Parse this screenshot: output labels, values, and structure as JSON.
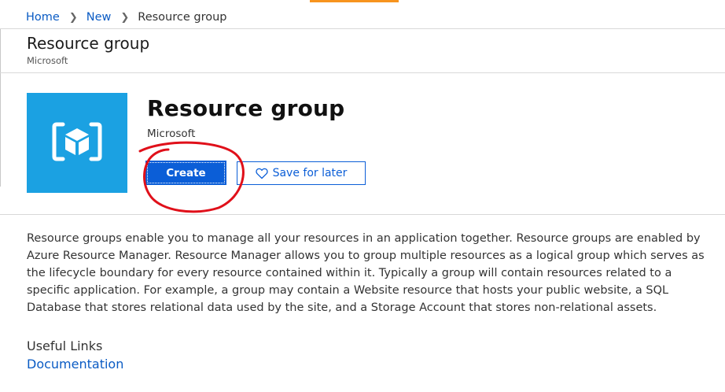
{
  "breadcrumb": {
    "home": "Home",
    "new": "New",
    "current": "Resource group"
  },
  "blade": {
    "title": "Resource group",
    "subtitle": "Microsoft"
  },
  "product": {
    "title": "Resource group",
    "publisher": "Microsoft",
    "icon": "resource-group-cube-icon"
  },
  "actions": {
    "create_label": "Create",
    "save_label": "Save for later",
    "save_icon": "heart-icon"
  },
  "description": "Resource groups enable you to manage all your resources in an application together. Resource groups are enabled by Azure Resource Manager. Resource Manager allows you to group multiple resources as a logical group which serves as the lifecycle boundary for every resource contained within it. Typically a group will contain resources related to a specific application. For example, a group may contain a Website resource that hosts your public website, a SQL Database that stores relational data used by the site, and a Storage Account that stores non-relational assets.",
  "useful_links": {
    "heading": "Useful Links",
    "items": [
      {
        "label": "Documentation"
      }
    ]
  },
  "colors": {
    "accent": "#0b5ed7",
    "tile": "#1ba1e2",
    "top_accent": "#f7941e",
    "annotation": "#e0101a"
  }
}
